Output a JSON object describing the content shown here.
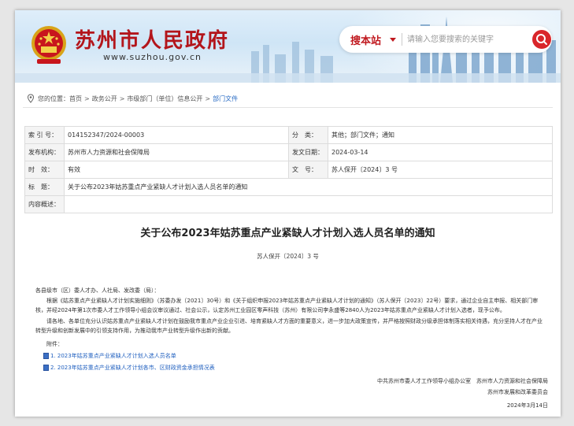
{
  "header": {
    "site_title": "苏州市人民政府",
    "site_url": "www.suzhou.gov.cn",
    "search_scope": "搜本站",
    "search_placeholder": "请输入您要搜索的关键字"
  },
  "breadcrumb": {
    "prefix": "您的位置：",
    "items": [
      "首页",
      "政务公开",
      "市级部门（单位）信息公开",
      "部门文件"
    ],
    "separator": ">"
  },
  "info": {
    "index_label": "索 引 号：",
    "index_value": "014152347/2024-00003",
    "category_label": "分　类：",
    "category_value": "其他；部门文件；通知",
    "issuer_label": "发布机构：",
    "issuer_value": "苏州市人力资源和社会保障局",
    "date_label": "发文日期：",
    "date_value": "2024-03-14",
    "validity_label": "时　效：",
    "validity_value": "有效",
    "docno_label": "文　号：",
    "docno_value": "苏人保开〔2024〕3 号",
    "title_label": "标　题：",
    "title_value": "关于公布2023年姑苏重点产业紧缺人才计划入选人员名单的通知",
    "summary_label": "内容概述：",
    "summary_value": ""
  },
  "article": {
    "title": "关于公布2023年姑苏重点产业紧缺人才计划入选人员名单的通知",
    "doc_number": "苏人保开〔2024〕3 号",
    "salutation": "各县级市（区）委人才办、人社局、发改委（局）：",
    "para1": "根据《姑苏重点产业紧缺人才计划实施细则》（苏委办发〔2021〕30号）和《关于组织申报2023年姑苏重点产业紧缺人才计划的通知》（苏人保开〔2023〕22号）要求，通过企业自主申报、相关部门审核，并经2024年第1次市委人才工作领导小组会议审议通过、社会公示，认定苏州工业园区零声科技（苏州）有限公司李永盛等2840人为2023年姑苏重点产业紧缺人才计划入选者，现予公布。",
    "para2": "请各地、各单位充分认识姑苏重点产业紧缺人才计划在鼓励我市重点产业企业引进、培育紧缺人才方面的重要意义，进一步加大政策宣传，并严格按照财政分级承担体制落实相关待遇，充分坚持人才在产业转型升级和创新发展中的引领支持作用，为推动我市产业转型升级作出新的贡献。",
    "attachments_label": "附件：",
    "attachments": [
      "1. 2023年姑苏重点产业紧缺人才计划入选人员名单",
      "2. 2023年姑苏重点产业紧缺人才计划各市、区财政资金承担情况表"
    ],
    "signers_line1": "中共苏州市委人才工作领导小组办公室　苏州市人力资源和社会保障局",
    "signers_line2": "苏州市发展和改革委员会",
    "sign_date": "2024年3月14日"
  },
  "colors": {
    "brand_red": "#b3151b",
    "link_blue": "#2b6cc4"
  }
}
